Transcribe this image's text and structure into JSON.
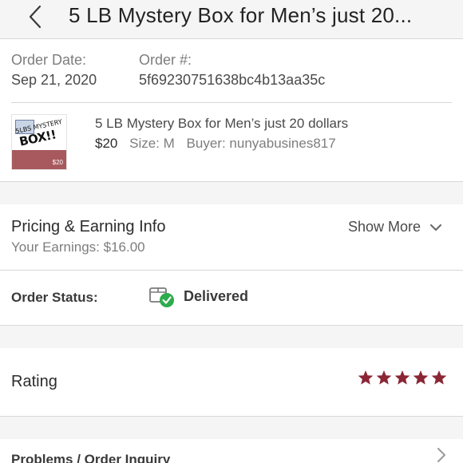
{
  "header": {
    "title": "5 LB Mystery Box for Men’s just 20..."
  },
  "order": {
    "date_label": "Order Date:",
    "date_value": "Sep 21, 2020",
    "number_label": "Order #:",
    "number_value": "5f69230751638bc4b13aa35c"
  },
  "item": {
    "thumbnail_text": "5LBS MYSTERY",
    "thumbnail_big": "BOX!!",
    "thumbnail_price": "$20",
    "title": "5 LB Mystery Box for Men’s just 20 dollars",
    "price": "$20",
    "size_label": "Size:",
    "size_value": "M",
    "buyer_label": "Buyer:",
    "buyer_value": "nunyabusines817"
  },
  "pricing": {
    "title": "Pricing & Earning Info",
    "earnings": "Your Earnings: $16.00",
    "show_more": "Show More"
  },
  "status": {
    "label": "Order Status:",
    "value": "Delivered"
  },
  "rating": {
    "label": "Rating",
    "stars": 5,
    "max_stars": 5
  },
  "problems": {
    "label": "Problems / Order Inquiry"
  },
  "colors": {
    "star": "#8b2635",
    "check": "#2eab4d",
    "band": "#f6f5f5",
    "divider": "#d9d7d7"
  },
  "icons": {
    "back": "chevron-left-icon",
    "show_more": "chevron-down-icon",
    "status": "package-delivered-icon",
    "star": "star-icon",
    "problems": "chevron-right-icon"
  }
}
